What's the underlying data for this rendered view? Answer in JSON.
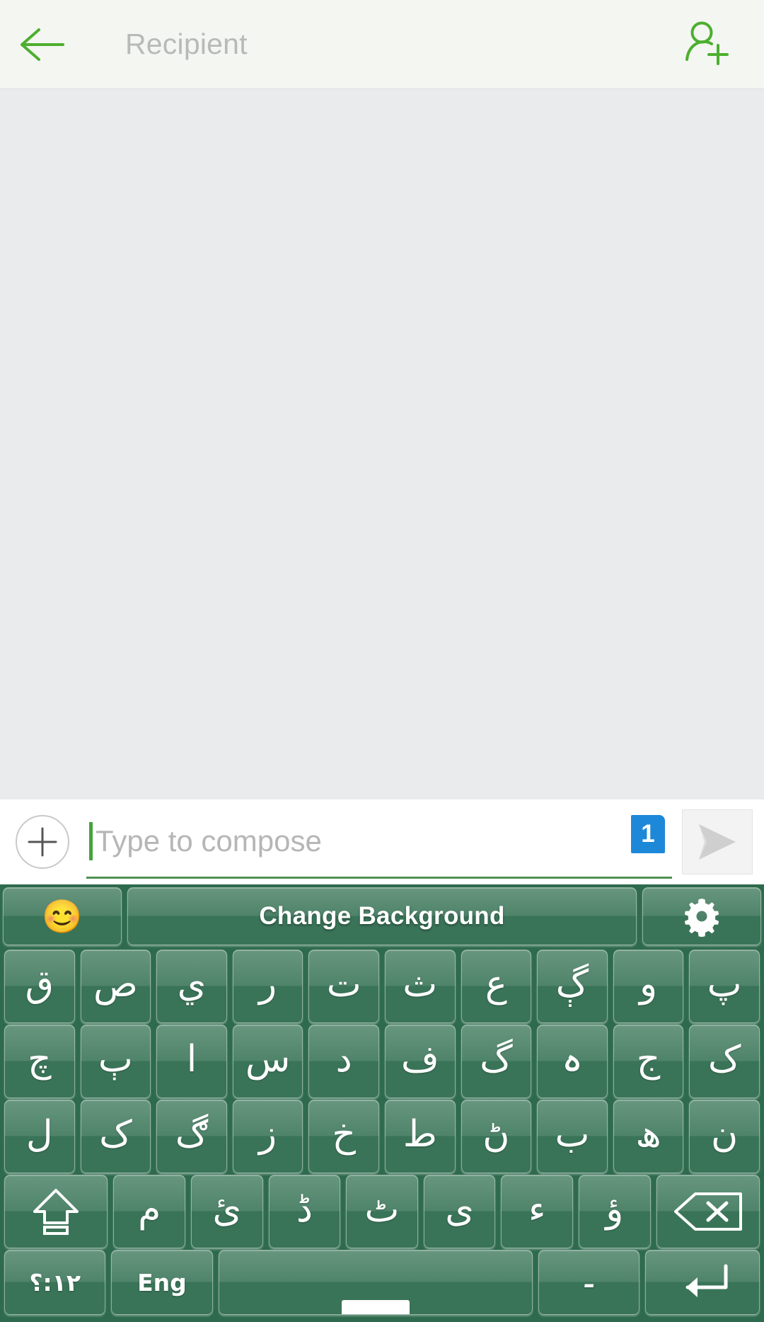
{
  "header": {
    "back_icon": "back-arrow-icon",
    "recipient_placeholder": "Recipient",
    "add_contact_icon": "add-person-icon",
    "accent_color": "#4caf2f",
    "background_color": "#f4f6f2"
  },
  "message_area": {
    "background_color": "#eaebed",
    "messages": []
  },
  "compose": {
    "attach_icon": "plus-icon",
    "placeholder": "Type to compose",
    "value": "",
    "sim_badge": "1",
    "sim_badge_color": "#1e88d8",
    "send_icon": "send-paper-plane-icon",
    "underline_color": "#4e9152",
    "caret_color": "#45a23f"
  },
  "keyboard": {
    "background_color": "#2e6a4d",
    "key_color": "#4b8167",
    "toolbar": {
      "emoji_icon": "smiley-face-icon",
      "emoji_glyph": "😊",
      "change_background_label": "Change Background",
      "settings_icon": "gear-icon"
    },
    "rows": [
      {
        "name": "row-1",
        "keys": [
          {
            "label": "ق",
            "name": "key-qaf"
          },
          {
            "label": "ص",
            "name": "key-sad"
          },
          {
            "label": "ي",
            "name": "key-ye"
          },
          {
            "label": "ر",
            "name": "key-re"
          },
          {
            "label": "ت",
            "name": "key-te"
          },
          {
            "label": "ث",
            "name": "key-se"
          },
          {
            "label": "ع",
            "name": "key-ain"
          },
          {
            "label": "ڳ",
            "name": "key-gaf-dots"
          },
          {
            "label": "و",
            "name": "key-vao"
          },
          {
            "label": "پ",
            "name": "key-pe"
          }
        ]
      },
      {
        "name": "row-2",
        "keys": [
          {
            "label": "چ",
            "name": "key-che"
          },
          {
            "label": "ٻ",
            "name": "key-be-dots"
          },
          {
            "label": "ا",
            "name": "key-alef"
          },
          {
            "label": "س",
            "name": "key-sin"
          },
          {
            "label": "د",
            "name": "key-dal"
          },
          {
            "label": "ف",
            "name": "key-fe"
          },
          {
            "label": "گ",
            "name": "key-gaf"
          },
          {
            "label": "ہ",
            "name": "key-he"
          },
          {
            "label": "ج",
            "name": "key-jim"
          },
          {
            "label": "ک",
            "name": "key-kaf"
          }
        ]
      },
      {
        "name": "row-3",
        "keys": [
          {
            "label": "ل",
            "name": "key-lam"
          },
          {
            "label": "ک",
            "name": "key-kaf-2"
          },
          {
            "label": "ڰ",
            "name": "key-gaf-ring"
          },
          {
            "label": "ز",
            "name": "key-ze"
          },
          {
            "label": "خ",
            "name": "key-khe"
          },
          {
            "label": "ط",
            "name": "key-toe"
          },
          {
            "label": "ڻ",
            "name": "key-pe-4dots"
          },
          {
            "label": "ب",
            "name": "key-be"
          },
          {
            "label": "ھ",
            "name": "key-do-chashmi-he"
          },
          {
            "label": "ن",
            "name": "key-nun"
          }
        ]
      },
      {
        "name": "row-4",
        "keys": [
          {
            "label": "",
            "name": "key-shift",
            "icon": "shift-up-arrow-icon",
            "wide": true
          },
          {
            "label": "م",
            "name": "key-mim"
          },
          {
            "label": "ئ",
            "name": "key-hamza-ye"
          },
          {
            "label": "ڈ",
            "name": "key-dal-tah"
          },
          {
            "label": "ٹ",
            "name": "key-te-tah"
          },
          {
            "label": "ی",
            "name": "key-bari-ye"
          },
          {
            "label": "ء",
            "name": "key-hamza"
          },
          {
            "label": "ؤ",
            "name": "key-hamza-vao"
          },
          {
            "label": "",
            "name": "key-backspace",
            "icon": "backspace-icon",
            "wide": true
          }
        ]
      },
      {
        "name": "row-5",
        "keys": [
          {
            "label": "١٢:؟",
            "name": "key-numbers-symbols"
          },
          {
            "label": "Eng",
            "name": "key-language-english"
          },
          {
            "label": "",
            "name": "key-space"
          },
          {
            "label": "۔",
            "name": "key-urdu-full-stop"
          },
          {
            "label": "",
            "name": "key-enter",
            "icon": "enter-return-icon"
          }
        ]
      }
    ]
  }
}
